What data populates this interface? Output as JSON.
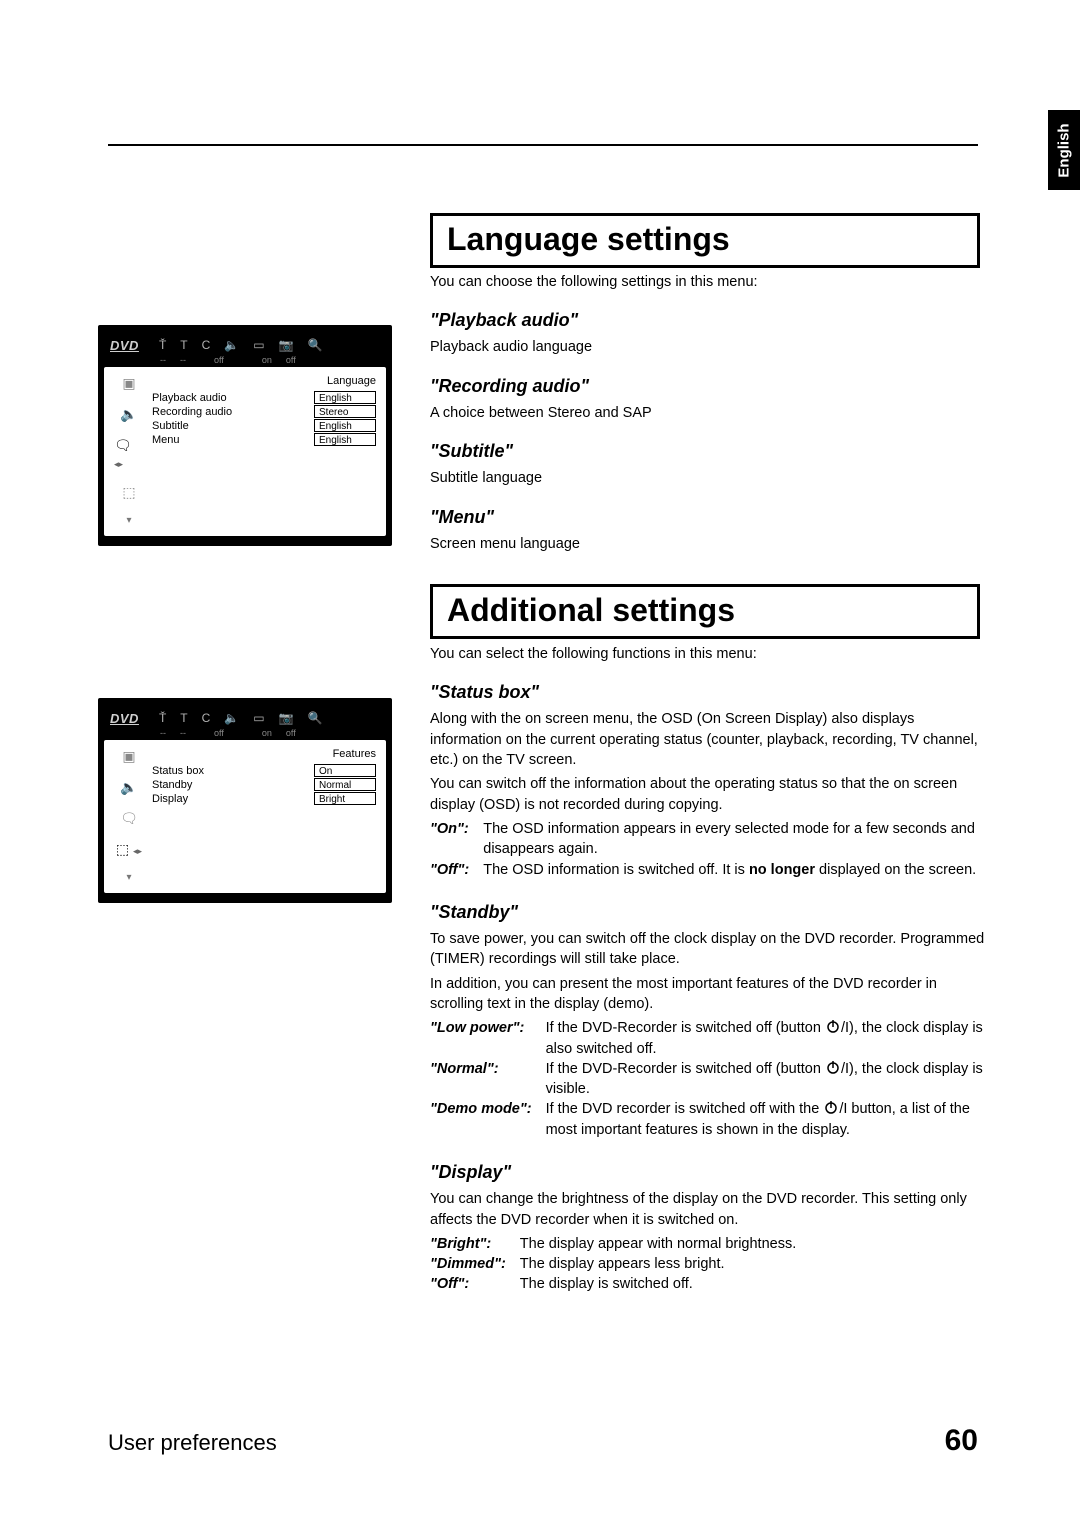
{
  "langTab": "English",
  "section1": {
    "title": "Language settings",
    "intro": "You can choose the following settings in this menu:",
    "items": [
      {
        "h": "\"Playback audio\"",
        "p": "Playback audio language"
      },
      {
        "h": "\"Recording audio\"",
        "p": "A choice between Stereo and SAP"
      },
      {
        "h": "\"Subtitle\"",
        "p": "Subtitle language"
      },
      {
        "h": "\"Menu\"",
        "p": "Screen menu language"
      }
    ]
  },
  "osd1": {
    "dvd": "DVD",
    "topStatus": [
      "",
      "--",
      "--",
      "",
      "off",
      "",
      "on",
      "off"
    ],
    "sectionLabel": "Language",
    "rows": [
      {
        "lbl": "Playback audio",
        "val": "English"
      },
      {
        "lbl": "Recording audio",
        "val": "Stereo"
      },
      {
        "lbl": "Subtitle",
        "val": "English"
      },
      {
        "lbl": "Menu",
        "val": "English"
      }
    ]
  },
  "section2": {
    "title": "Additional settings",
    "intro": "You can select the following functions in this menu:"
  },
  "osd2": {
    "dvd": "DVD",
    "topStatus": [
      "",
      "--",
      "--",
      "",
      "off",
      "",
      "on",
      "off"
    ],
    "sectionLabel": "Features",
    "rows": [
      {
        "lbl": "Status box",
        "val": "On"
      },
      {
        "lbl": "Standby",
        "val": "Normal"
      },
      {
        "lbl": "Display",
        "val": "Bright"
      }
    ]
  },
  "statusBox": {
    "h": "\"Status box\"",
    "p1": "Along with the on screen menu, the OSD (On Screen Display) also displays information on the current operating status (counter, playback, recording, TV channel, etc.) on the TV screen.",
    "p2": "You can switch off the information about the operating status so that the on screen display (OSD) is not recorded during copying.",
    "opts": [
      {
        "term": "\"On\":",
        "def": "The OSD information appears in every selected mode for a few seconds and disappears again."
      },
      {
        "term": "\"Off\":",
        "defPre": "The OSD information is switched off. It is ",
        "defBold": "no longer",
        "defPost": " displayed on the screen."
      }
    ]
  },
  "standby": {
    "h": "\"Standby\"",
    "p1": "To save power, you can switch off the clock display on the DVD recorder. Programmed (TIMER) recordings will still take place.",
    "p2": "In addition, you can present the most important features of the DVD recorder in scrolling text in the display (demo).",
    "opts": [
      {
        "term": "\"Low power\":",
        "pre": "If the DVD-Recorder is switched off (button ",
        "post": "/I), the clock display is also switched off."
      },
      {
        "term": "\"Normal\":",
        "pre": "If the DVD-Recorder is switched off (button ",
        "post": "/I), the clock display is visible."
      },
      {
        "term": "\"Demo mode\":",
        "pre": "If the DVD recorder is switched off with the ",
        "post": "/I button, a list of the most important features is shown in the display."
      }
    ]
  },
  "display": {
    "h": "\"Display\"",
    "p1": "You can change the brightness of the display on the DVD recorder. This setting only affects the DVD recorder when it is switched on.",
    "opts": [
      {
        "term": "\"Bright\":",
        "def": "The display appear with normal brightness."
      },
      {
        "term": "\"Dimmed\":",
        "def": "The display appears less bright."
      },
      {
        "term": "\"Off\":",
        "def": "The display is switched off."
      }
    ]
  },
  "footer": {
    "left": "User preferences",
    "right": "60"
  }
}
